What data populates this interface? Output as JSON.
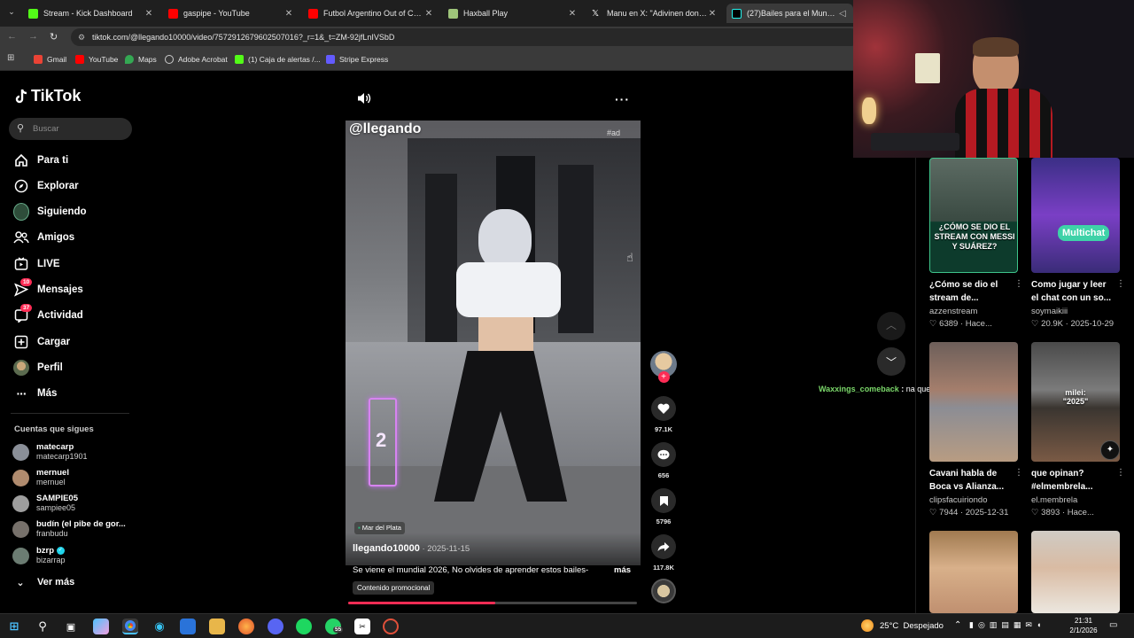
{
  "browser": {
    "tabs": [
      {
        "title": "Stream - Kick Dashboard",
        "color": "#53fc18"
      },
      {
        "title": "gaspipe - YouTube",
        "color": "#ff0000"
      },
      {
        "title": "Futbol Argentino Out of Conte",
        "color": "#ff0000"
      },
      {
        "title": "Haxball Play",
        "color": "#9ec47a"
      },
      {
        "title": "Manu en X: \"Adivinen donde va",
        "color": "#ffffff"
      },
      {
        "title": "(27)Bailes para el Mundial",
        "color": "#25f4ee"
      }
    ],
    "url": "tiktok.com/@llegando10000/video/7572912679602507016?_r=1&_t=ZM-92jfLnIVSbD",
    "bookmarks": [
      {
        "label": "Gmail",
        "color": "#ea4335"
      },
      {
        "label": "YouTube",
        "color": "#ff0000"
      },
      {
        "label": "Maps",
        "color": "#34a853"
      },
      {
        "label": "Adobe Acrobat",
        "color": "#d0d0d0"
      },
      {
        "label": "(1) Caja de alertas /...",
        "color": "#53fc18"
      },
      {
        "label": "Stripe Express",
        "color": "#635bff"
      }
    ]
  },
  "sidebar": {
    "logo": "TikTok",
    "search_placeholder": "Buscar",
    "nav": [
      {
        "label": "Para ti",
        "icon": "home-icon"
      },
      {
        "label": "Explorar",
        "icon": "compass-icon"
      },
      {
        "label": "Siguiendo",
        "icon": "following-avatar-icon"
      },
      {
        "label": "Amigos",
        "icon": "friends-icon"
      },
      {
        "label": "LIVE",
        "icon": "live-icon"
      },
      {
        "label": "Mensajes",
        "icon": "messages-icon",
        "badge": "10"
      },
      {
        "label": "Actividad",
        "icon": "activity-icon",
        "badge": "37"
      },
      {
        "label": "Cargar",
        "icon": "upload-icon"
      },
      {
        "label": "Perfil",
        "icon": "profile-icon"
      },
      {
        "label": "Más",
        "icon": "more-icon"
      }
    ],
    "following_title": "Cuentas que sigues",
    "following": [
      {
        "name": "matecarp",
        "handle": "matecarp1901"
      },
      {
        "name": "mernuel",
        "handle": "mernuel"
      },
      {
        "name": "SAMPIE05",
        "handle": "sampiee05"
      },
      {
        "name": "budín (el pibe de gor...",
        "handle": "franbudu"
      },
      {
        "name": "bzrp",
        "handle": "bizarrap",
        "verified": true
      }
    ],
    "see_more": "Ver más"
  },
  "video": {
    "watermark_user": "@llegando",
    "ad_tag": "#ad",
    "sticker_number": "2",
    "location": "Mar del Plata",
    "author": "llegando10000",
    "date": "2025-11-15",
    "caption": "Se viene el mundial 2026, No olvides de aprender estos bailes-",
    "more": "más",
    "promo": "Contenido promocional",
    "progress": 0.51
  },
  "actions": {
    "likes": "97.1K",
    "comments": "656",
    "saves": "5796",
    "shares": "117.8K"
  },
  "chat_overlay": {
    "user": "Waxxings_comeback",
    "message": "na que pasan amigo"
  },
  "recommended": [
    {
      "title": "¿Cómo se dio el stream de...",
      "user": "azzenstream",
      "likes": "6389",
      "when": "Hace...",
      "thumb_text": "¿CÓMO SE DIO EL STREAM CON MESSI Y SUÁREZ?"
    },
    {
      "title": "Como jugar y leer el chat con un so...",
      "user": "soymaikiii",
      "likes": "20.9K",
      "when": "2025-10-29",
      "thumb_text": "Multichat"
    },
    {
      "title": "Cavani habla de Boca vs Alianza...",
      "user": "clipsfacuiriondo",
      "likes": "7944",
      "when": "2025-12-31",
      "thumb_text": ""
    },
    {
      "title": "que opinan? #elmembrela...",
      "user": "el.membrela",
      "likes": "3893",
      "when": "Hace...",
      "thumb_text": "milei: \"2025\""
    }
  ],
  "taskbar": {
    "temperature": "25°C",
    "weather": "Despejado",
    "time": "21:31",
    "date": "2/1/2026",
    "whatsapp_badge": "55"
  }
}
